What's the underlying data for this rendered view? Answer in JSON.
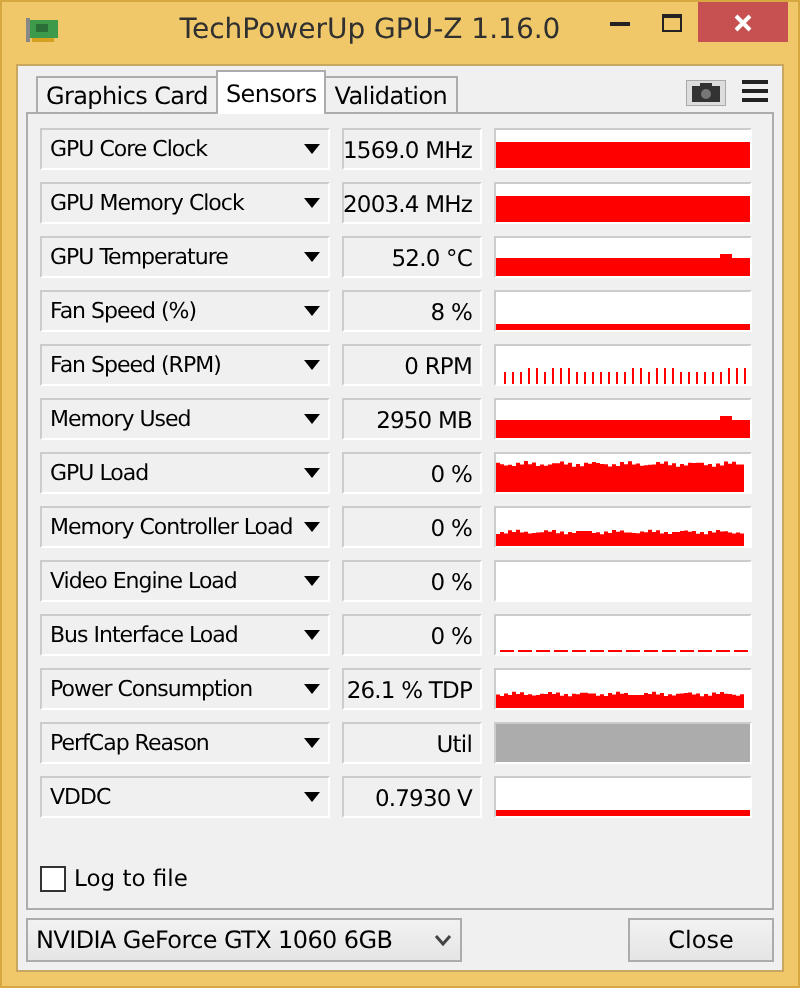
{
  "window": {
    "title": "TechPowerUp GPU-Z 1.16.0"
  },
  "tabs": [
    {
      "label": "Graphics Card",
      "selected": false
    },
    {
      "label": "Sensors",
      "selected": true
    },
    {
      "label": "Validation",
      "selected": false
    }
  ],
  "sensors": [
    {
      "name": "GPU Core Clock",
      "value": "1569.0 MHz",
      "kind": "full"
    },
    {
      "name": "GPU Memory Clock",
      "value": "2003.4 MHz",
      "kind": "full"
    },
    {
      "name": "GPU Temperature",
      "value": "52.0 °C",
      "kind": "mid"
    },
    {
      "name": "Fan Speed (%)",
      "value": "8 %",
      "kind": "line"
    },
    {
      "name": "Fan Speed (RPM)",
      "value": "0 RPM",
      "kind": "pulses"
    },
    {
      "name": "Memory Used",
      "value": "2950 MB",
      "kind": "mid"
    },
    {
      "name": "GPU Load",
      "value": "0 %",
      "kind": "noisy"
    },
    {
      "name": "Memory Controller Load",
      "value": "0 %",
      "kind": "noisy_low"
    },
    {
      "name": "Video Engine Load",
      "value": "0 %",
      "kind": "empty"
    },
    {
      "name": "Bus Interface Load",
      "value": "0 %",
      "kind": "dashes"
    },
    {
      "name": "Power Consumption",
      "value": "26.1 % TDP",
      "kind": "noisy_low"
    },
    {
      "name": "PerfCap Reason",
      "value": "Util",
      "kind": "disabled"
    },
    {
      "name": "VDDC",
      "value": "0.7930 V",
      "kind": "line"
    }
  ],
  "log_to_file": {
    "label": "Log to file",
    "checked": false
  },
  "device": {
    "value": "NVIDIA GeForce GTX 1060 6GB"
  },
  "buttons": [
    {
      "label": "Close"
    }
  ]
}
